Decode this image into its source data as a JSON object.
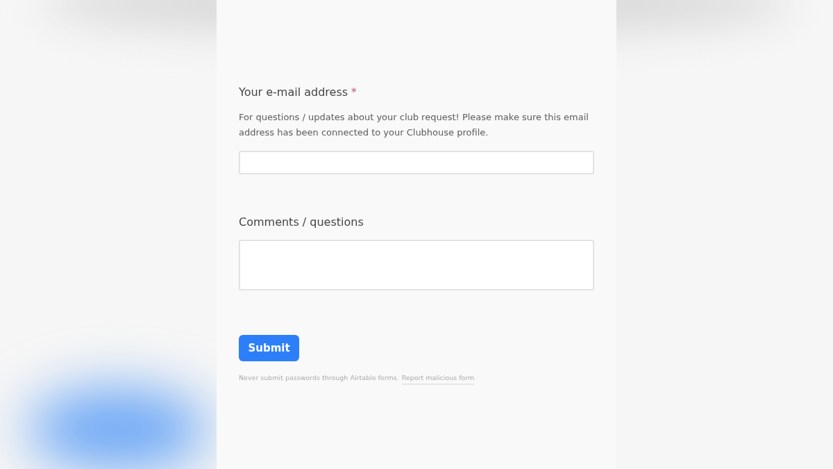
{
  "form": {
    "fields": [
      {
        "kind": "input",
        "label": "Your e-mail address",
        "required_mark": "*",
        "description": "For questions / updates about your club request! Please make sure this email address has been connected to your Clubhouse profile."
      },
      {
        "kind": "textarea",
        "label": "Comments / questions"
      }
    ],
    "submit": "Submit",
    "footer": {
      "notice": "Never submit passwords through Airtable forms.",
      "link": "Report malicious form"
    }
  }
}
